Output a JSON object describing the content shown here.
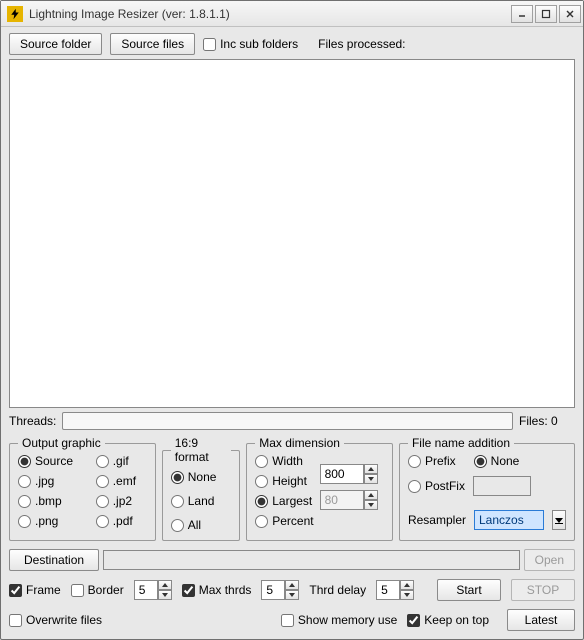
{
  "window": {
    "title": "Lightning Image Resizer (ver: 1.8.1.1)",
    "minimize": "–",
    "maximize": "☐",
    "close": "✕"
  },
  "toolbar": {
    "source_folder": "Source folder",
    "source_files": "Source files",
    "inc_sub_folders": "Inc sub folders",
    "files_processed_label": "Files processed:"
  },
  "progress": {
    "threads_label": "Threads:",
    "files_count_label": "Files: 0"
  },
  "output_graphic": {
    "legend": "Output graphic",
    "options": [
      "Source",
      ".gif",
      ".jpg",
      ".emf",
      ".bmp",
      ".jp2",
      ".png",
      ".pdf"
    ],
    "selected": "Source"
  },
  "format169": {
    "legend": "16:9 format",
    "options": [
      "None",
      "Land",
      "All"
    ],
    "selected": "None"
  },
  "max_dim": {
    "legend": "Max dimension",
    "options": [
      "Width",
      "Height",
      "Largest",
      "Percent"
    ],
    "selected": "Largest",
    "value1": "800",
    "value2": "80"
  },
  "filename": {
    "legend": "File name addition",
    "options": [
      "Prefix",
      "None",
      "PostFix"
    ],
    "selected": "None",
    "postfix_value": "",
    "resampler_label": "Resampler",
    "resampler_value": "Lanczos"
  },
  "dest": {
    "destination_label": "Destination",
    "path": "",
    "open_label": "Open"
  },
  "bottom": {
    "frame": "Frame",
    "border": "Border",
    "border_value": "5",
    "max_thrds": "Max thrds",
    "max_thrds_value": "5",
    "thrd_delay": "Thrd delay",
    "thrd_delay_value": "5",
    "start": "Start",
    "stop": "STOP",
    "overwrite": "Overwrite files",
    "show_mem": "Show memory use",
    "keep_on_top": "Keep on top",
    "latest": "Latest"
  }
}
